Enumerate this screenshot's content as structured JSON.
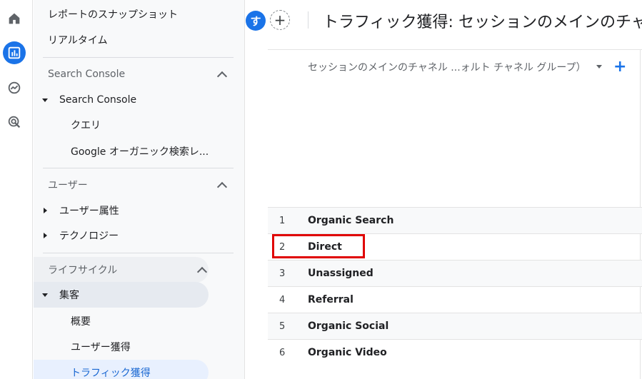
{
  "rail": {
    "items": [
      {
        "icon": "home-icon"
      },
      {
        "icon": "reports-icon",
        "active": true
      },
      {
        "icon": "explore-icon"
      },
      {
        "icon": "advertising-icon"
      }
    ]
  },
  "nav": {
    "snapshot": "レポートのスナップショット",
    "realtime": "リアルタイム",
    "section_search_console": "Search Console",
    "search_console_group": "Search Console",
    "queries": "クエリ",
    "google_organic": "Google オーガニック検索レ...",
    "section_user": "ユーザー",
    "user_attributes": "ユーザー属性",
    "technology": "テクノロジー",
    "section_lifecycle": "ライフサイクル",
    "acquisition": "集客",
    "overview": "概要",
    "user_acquisition": "ユーザー獲得",
    "traffic_acquisition": "トラフィック獲得"
  },
  "header": {
    "avatar_letter": "す",
    "add_comparison": "+",
    "title": "トラフィック獲得: セッションのメインのチャ"
  },
  "table": {
    "dimension_header": "セッションのメインのチャネル ...ォルト チャネル グループ）",
    "add_dimension": "+",
    "rows": [
      {
        "index": "1",
        "channel": "Organic Search"
      },
      {
        "index": "2",
        "channel": "Direct"
      },
      {
        "index": "3",
        "channel": "Unassigned"
      },
      {
        "index": "4",
        "channel": "Referral"
      },
      {
        "index": "5",
        "channel": "Organic Social"
      },
      {
        "index": "6",
        "channel": "Organic Video"
      }
    ]
  },
  "colors": {
    "accent": "#1a73e8",
    "highlight": "#e00000"
  }
}
